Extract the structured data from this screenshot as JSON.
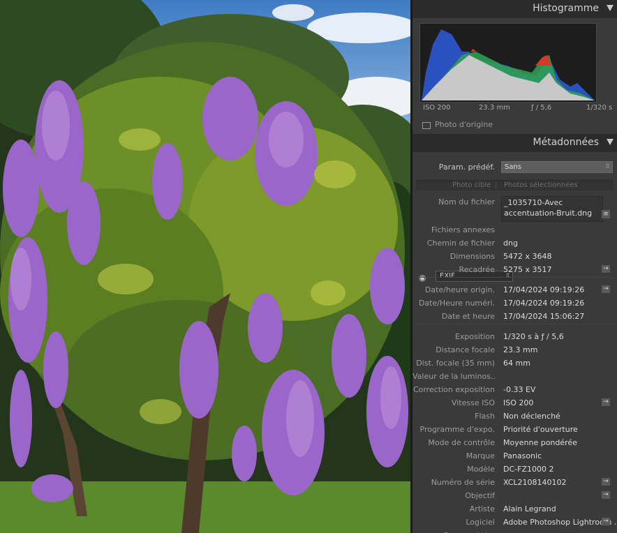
{
  "histogram": {
    "title": "Histogramme",
    "iso": "ISO 200",
    "focal": "23.3 mm",
    "aperture": "ƒ / 5,6",
    "shutter": "1/320 s",
    "original_photo_label": "Photo d'origine"
  },
  "metadata": {
    "title": "Métadonnées",
    "view_select": "EXIF",
    "preset_label": "Param. prédéf.",
    "preset_value": "Sans",
    "tab_target": "Photo cible",
    "tab_selected": "Photos sélectionnées",
    "filename_label": "Nom du fichier",
    "filename_line1": "_1035710-Avec",
    "filename_line2": "accentuation-Bruit.dng",
    "fields": [
      {
        "label": "Fichiers annexes",
        "value": ""
      },
      {
        "label": "Chemin de fichier",
        "value": "dng"
      },
      {
        "label": "Dimensions",
        "value": "5472 x 3648"
      },
      {
        "label": "Recadrée",
        "value": "5275 x 3517"
      },
      {
        "label": "Date/heure origin.",
        "value": "17/04/2024 09:19:26"
      },
      {
        "label": "Date/Heure numéri.",
        "value": "17/04/2024 09:19:26"
      },
      {
        "label": "Date et heure",
        "value": "17/04/2024 15:06:27"
      },
      {
        "label": "Exposition",
        "value": "1/320 s à ƒ / 5,6"
      },
      {
        "label": "Distance focale",
        "value": "23.3 mm"
      },
      {
        "label": "Dist. focale (35 mm)",
        "value": "64 mm"
      },
      {
        "label": "Valeur de la luminos...",
        "value": ""
      },
      {
        "label": "Correction exposition",
        "value": "-0.33 EV"
      },
      {
        "label": "Vitesse ISO",
        "value": "ISO 200"
      },
      {
        "label": "Flash",
        "value": "Non déclenché"
      },
      {
        "label": "Programme d'expo.",
        "value": "Priorité d'ouverture"
      },
      {
        "label": "Mode de contrôle",
        "value": "Moyenne pondérée"
      },
      {
        "label": "Marque",
        "value": "Panasonic"
      },
      {
        "label": "Modèle",
        "value": "DC-FZ1000 2"
      },
      {
        "label": "Numéro de série",
        "value": "XCL2108140102"
      },
      {
        "label": "Objectif",
        "value": ""
      },
      {
        "label": "Artiste",
        "value": "Alain Legrand"
      },
      {
        "label": "Logiciel",
        "value": "Adobe Photoshop Lightroom ..."
      },
      {
        "label": "Commentaire",
        "value": ""
      }
    ]
  },
  "icons": {
    "goto": "→",
    "dropdown": "⇕",
    "list": "≡",
    "eye": "◉"
  }
}
